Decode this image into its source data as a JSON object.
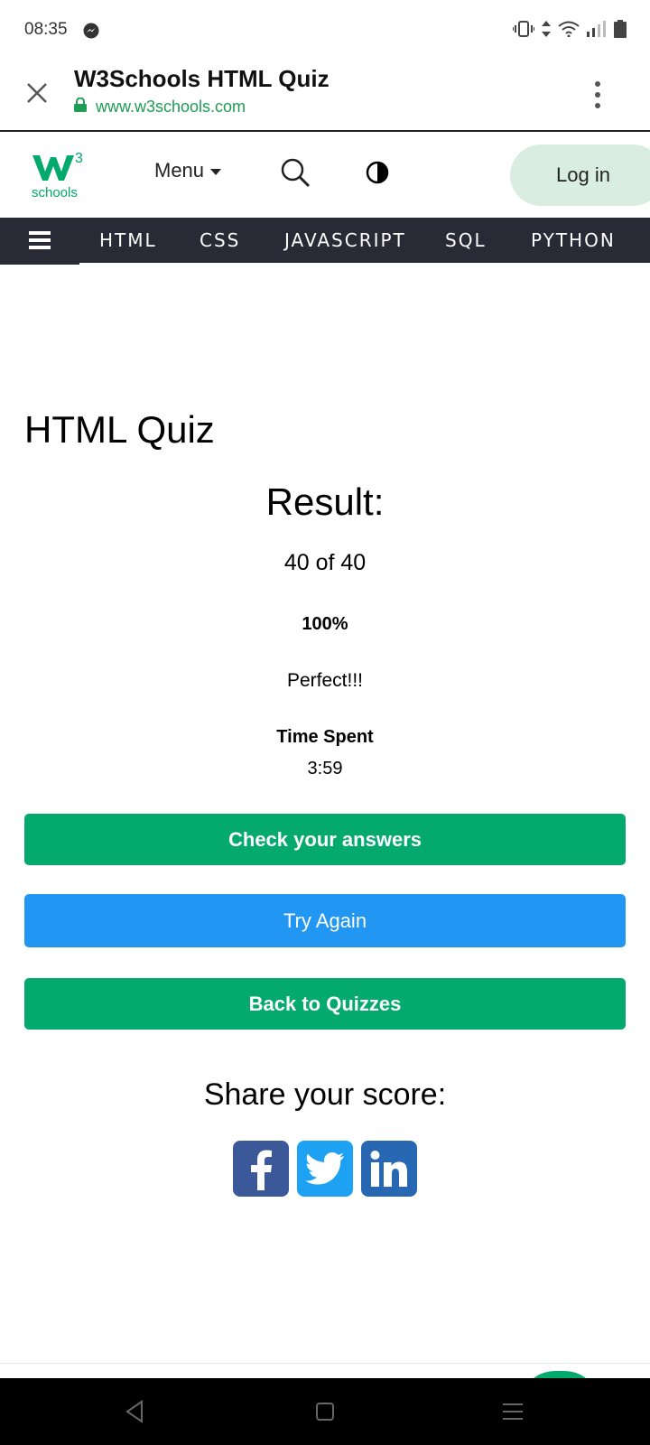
{
  "status_bar": {
    "time": "08:35",
    "notification_icon": "messenger-icon",
    "system_icons": [
      "vibrate-icon",
      "data-arrows-icon",
      "wifi-icon",
      "signal-icon",
      "battery-icon"
    ]
  },
  "custom_tab": {
    "title": "W3Schools HTML Quiz",
    "url": "www.w3schools.com",
    "close_icon": "close-icon",
    "lock_icon": "lock-icon",
    "menu_icon": "kebab-menu-icon"
  },
  "site_header": {
    "logo_text": "schools",
    "logo_superscript": "3",
    "menu_label": "Menu",
    "login_label": "Log in"
  },
  "nav": {
    "items": [
      "HTML",
      "CSS",
      "JAVASCRIPT",
      "SQL",
      "PYTHON"
    ]
  },
  "quiz": {
    "title": "HTML Quiz",
    "result_heading": "Result:",
    "score": "40 of 40",
    "percent": "100%",
    "verdict": "Perfect!!!",
    "time_label": "Time Spent",
    "time_value": "3:59"
  },
  "actions": {
    "check_answers": "Check your answers",
    "try_again": "Try Again",
    "back_to_quizzes": "Back to Quizzes"
  },
  "share": {
    "heading": "Share your score:",
    "icons": [
      "facebook-icon",
      "twitter-icon",
      "linkedin-icon"
    ]
  },
  "colors": {
    "brand_green": "#04aa6d",
    "try_again_blue": "#2196f3",
    "nav_dark": "#282a35",
    "login_bg": "#d9eee1",
    "facebook": "#3b5998",
    "twitter": "#1da1f2",
    "linkedin": "#2867b2"
  }
}
